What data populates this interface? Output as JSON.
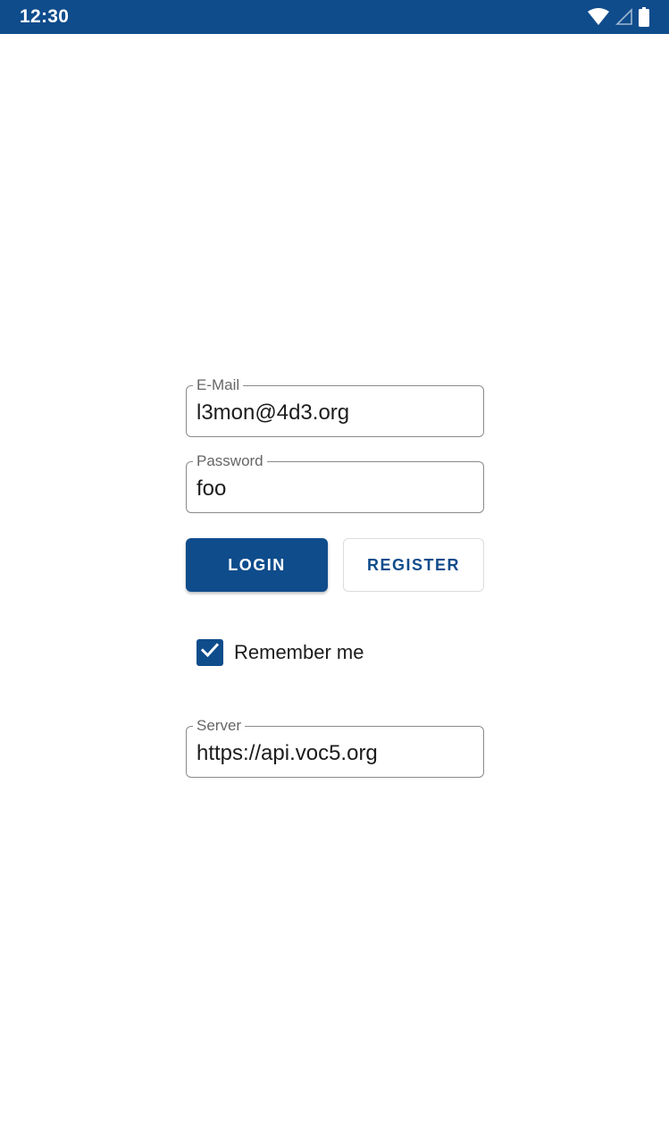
{
  "status_bar": {
    "time": "12:30",
    "background_color": "#0f4c8c",
    "icons": [
      "wifi-icon",
      "cellular-signal-icon",
      "battery-icon"
    ]
  },
  "login_form": {
    "email": {
      "label": "E-Mail",
      "value": "l3mon@4d3.org"
    },
    "password": {
      "label": "Password",
      "value": "foo"
    },
    "login_button": "LOGIN",
    "register_button": "REGISTER",
    "remember_me": {
      "label": "Remember me",
      "checked": true
    },
    "server": {
      "label": "Server",
      "value": "https://api.voc5.org"
    }
  },
  "colors": {
    "primary": "#0f4c8c",
    "outline": "#8a8a8a"
  }
}
